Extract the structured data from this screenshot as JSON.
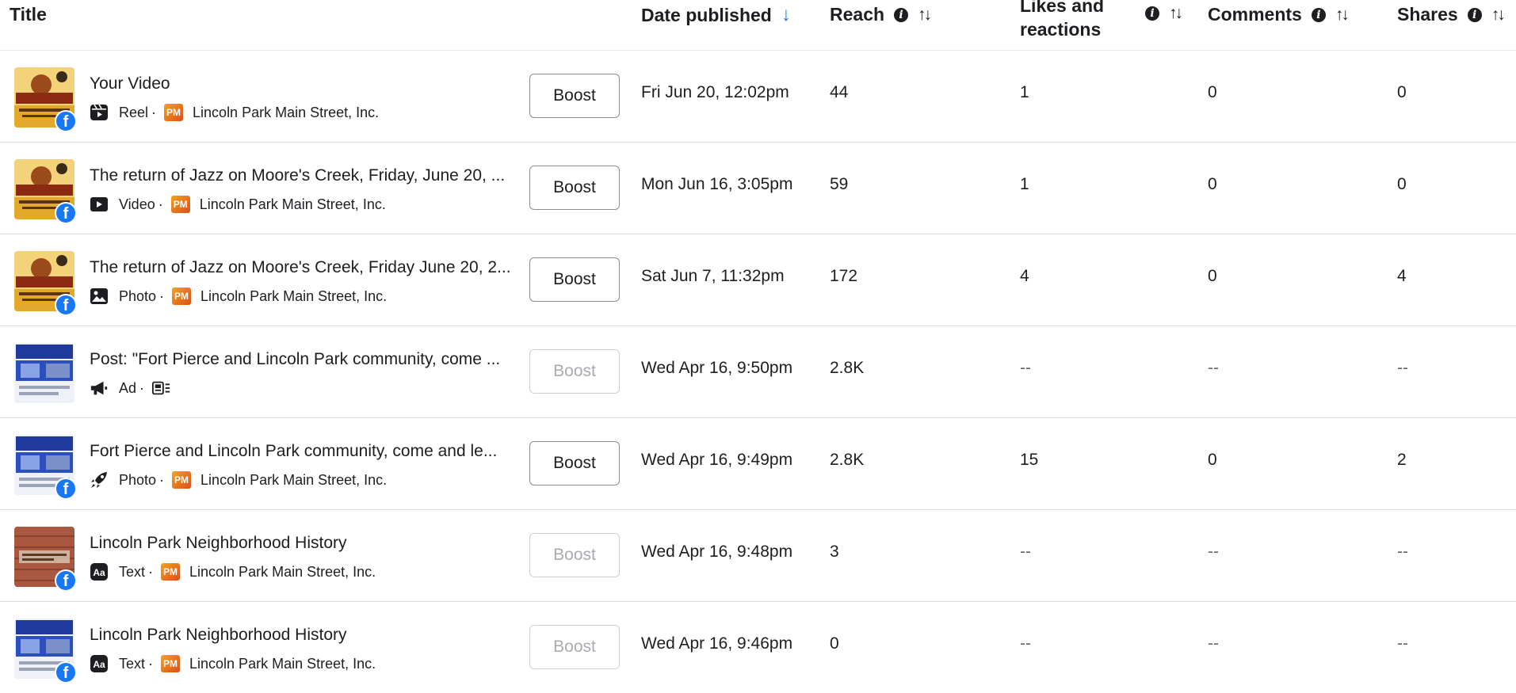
{
  "header": {
    "title": "Title",
    "date": "Date published",
    "reach": "Reach",
    "likes_line1": "Likes and",
    "likes_line2": "reactions",
    "comments": "Comments",
    "shares": "Shares"
  },
  "rows": [
    {
      "title": "Your Video",
      "type": "Reel",
      "page": "Lincoln Park Main Street, Inc.",
      "boost": "Boost",
      "date": "Fri Jun 20, 12:02pm",
      "reach": "44",
      "likes": "1",
      "comments": "0",
      "shares": "0"
    },
    {
      "title": "The return of Jazz on Moore's Creek, Friday, June 20, ...",
      "type": "Video",
      "page": "Lincoln Park Main Street, Inc.",
      "boost": "Boost",
      "date": "Mon Jun 16, 3:05pm",
      "reach": "59",
      "likes": "1",
      "comments": "0",
      "shares": "0"
    },
    {
      "title": "The return of Jazz on Moore's Creek, Friday June 20, 2...",
      "type": "Photo",
      "page": "Lincoln Park Main Street, Inc.",
      "boost": "Boost",
      "date": "Sat Jun 7, 11:32pm",
      "reach": "172",
      "likes": "4",
      "comments": "0",
      "shares": "4"
    },
    {
      "title": "Post: \"Fort Pierce and Lincoln Park community, come ...",
      "type": "Ad",
      "page": "",
      "boost": "Boost",
      "date": "Wed Apr 16, 9:50pm",
      "reach": "2.8K",
      "likes": "--",
      "comments": "--",
      "shares": "--"
    },
    {
      "title": "Fort Pierce and Lincoln Park community, come and le...",
      "type": "Photo",
      "page": "Lincoln Park Main Street, Inc.",
      "boost": "Boost",
      "date": "Wed Apr 16, 9:49pm",
      "reach": "2.8K",
      "likes": "15",
      "comments": "0",
      "shares": "2"
    },
    {
      "title": "Lincoln Park Neighborhood History",
      "type": "Text",
      "page": "Lincoln Park Main Street, Inc.",
      "boost": "Boost",
      "date": "Wed Apr 16, 9:48pm",
      "reach": "3",
      "likes": "--",
      "comments": "--",
      "shares": "--"
    },
    {
      "title": "Lincoln Park Neighborhood History",
      "type": "Text",
      "page": "Lincoln Park Main Street, Inc.",
      "boost": "Boost",
      "date": "Wed Apr 16, 9:46pm",
      "reach": "0",
      "likes": "--",
      "comments": "--",
      "shares": "--"
    }
  ],
  "icons": {
    "info": "info-icon",
    "sort": "sort-icon",
    "sort_desc": "arrow-down-icon",
    "facebook_badge": "facebook-icon"
  },
  "colors": {
    "accent": "#1877f2",
    "text": "#1c1e21",
    "muted": "#65676b"
  }
}
